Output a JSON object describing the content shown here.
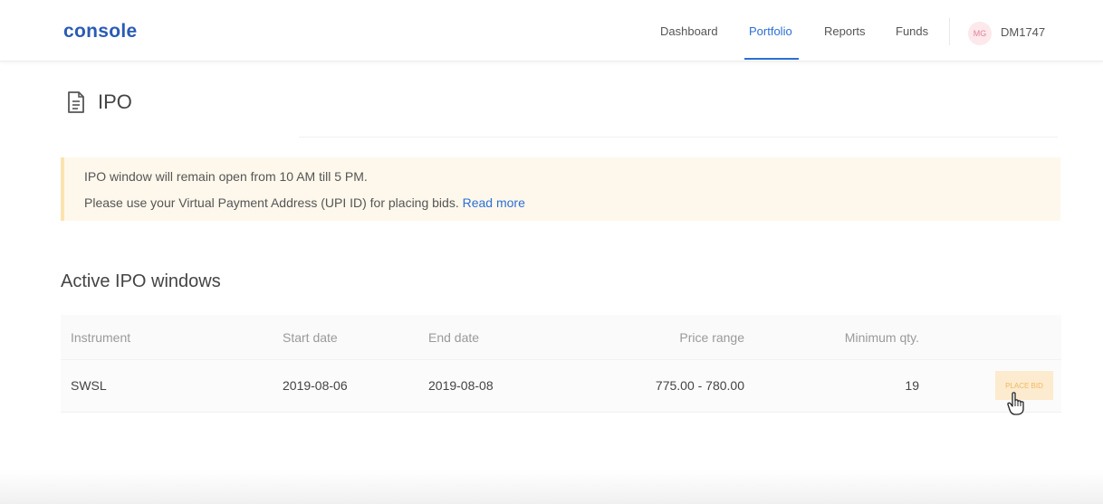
{
  "header": {
    "logo": "console",
    "nav": [
      {
        "label": "Dashboard",
        "active": false
      },
      {
        "label": "Portfolio",
        "active": true
      },
      {
        "label": "Reports",
        "active": false
      },
      {
        "label": "Funds",
        "active": false
      }
    ],
    "user": {
      "initials": "MG",
      "id": "DM1747"
    }
  },
  "page": {
    "icon": "document-icon",
    "title": "IPO"
  },
  "notice": {
    "line1": "IPO window will remain open from 10 AM till 5 PM.",
    "line2": "Please use your Virtual Payment Address (UPI ID) for placing bids.",
    "link": "Read more"
  },
  "section": {
    "title": "Active IPO windows"
  },
  "table": {
    "columns": [
      "Instrument",
      "Start date",
      "End date",
      "Price range",
      "Minimum qty."
    ],
    "rows": [
      {
        "instrument": "SWSL",
        "start_date": "2019-08-06",
        "end_date": "2019-08-08",
        "price_range": "775.00 - 780.00",
        "min_qty": "19",
        "action": "PLACE BID"
      }
    ]
  },
  "colors": {
    "brand": "#2a5bb5",
    "accent": "#2a6fd6",
    "notice_bg": "#fef8ec",
    "bid_button_bg": "#fdebcf"
  }
}
